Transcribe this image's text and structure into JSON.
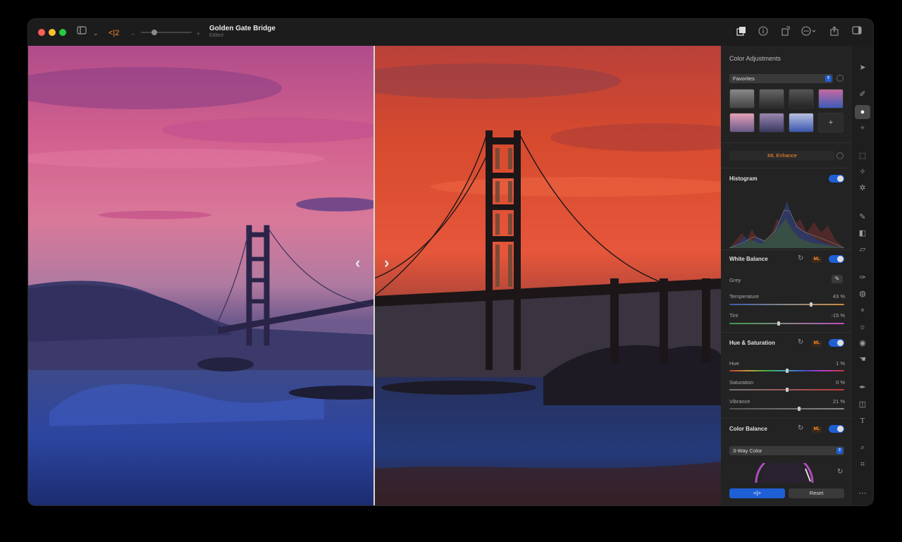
{
  "window": {
    "title": "Golden Gate Bridge",
    "subtitle": "Edited",
    "compare_icon_label": "<|2",
    "colors": {
      "close": "#ff5f57",
      "minimize": "#febc2e",
      "zoom": "#28c840",
      "accent": "#1f5fd6",
      "ml": "#ff8c2a"
    }
  },
  "toolbar": {
    "icons": [
      "sidebar-icon",
      "chevron-down-icon",
      "compare-icon",
      "zoom-out-icon",
      "zoom-in-icon",
      "layers-icon",
      "info-icon",
      "rotate-icon",
      "more-icon",
      "share-icon",
      "sidebar-right-icon"
    ]
  },
  "canvas": {
    "left_arrow": "‹",
    "right_arrow": "›"
  },
  "panel": {
    "title": "Color Adjustments",
    "presets_select": "Favorites",
    "add_preset": "+",
    "ml_enhance": "ML Enhance",
    "histogram": {
      "title": "Histogram",
      "enabled": true
    },
    "white_balance": {
      "title": "White Balance",
      "ml_badge": "ML",
      "enabled": true,
      "grey_label": "Grey",
      "temperature": {
        "label": "Temperature",
        "value": "43 %",
        "level": 0.72
      },
      "tint": {
        "label": "Tint",
        "value": "-15 %",
        "level": 0.43
      }
    },
    "hue_saturation": {
      "title": "Hue & Saturation",
      "ml_badge": "ML",
      "enabled": true,
      "hue": {
        "label": "Hue",
        "value": "1 %",
        "level": 0.5
      },
      "saturation": {
        "label": "Saturation",
        "value": "0 %",
        "level": 0.5
      },
      "vibrance": {
        "label": "Vibrance",
        "value": "21 %",
        "level": 0.6
      }
    },
    "color_balance": {
      "title": "Color Balance",
      "ml_badge": "ML",
      "enabled": true,
      "mode_select": "3-Way Color"
    },
    "compare_button": "<|>",
    "reset_button": "Reset"
  },
  "tools": [
    "pointer-icon",
    "brush-icon",
    "color-adjust-icon",
    "magic-icon",
    "select-rect-icon",
    "wand-icon",
    "sparkle-icon",
    "paint-icon",
    "bucket-icon",
    "eraser-icon",
    "pen-icon",
    "retouch-icon",
    "blur-icon",
    "light-icon",
    "clone-icon",
    "smudge-icon",
    "vector-pen-icon",
    "shapes-icon",
    "text-icon",
    "zoom-icon",
    "crop-icon",
    "more-tools-icon"
  ]
}
